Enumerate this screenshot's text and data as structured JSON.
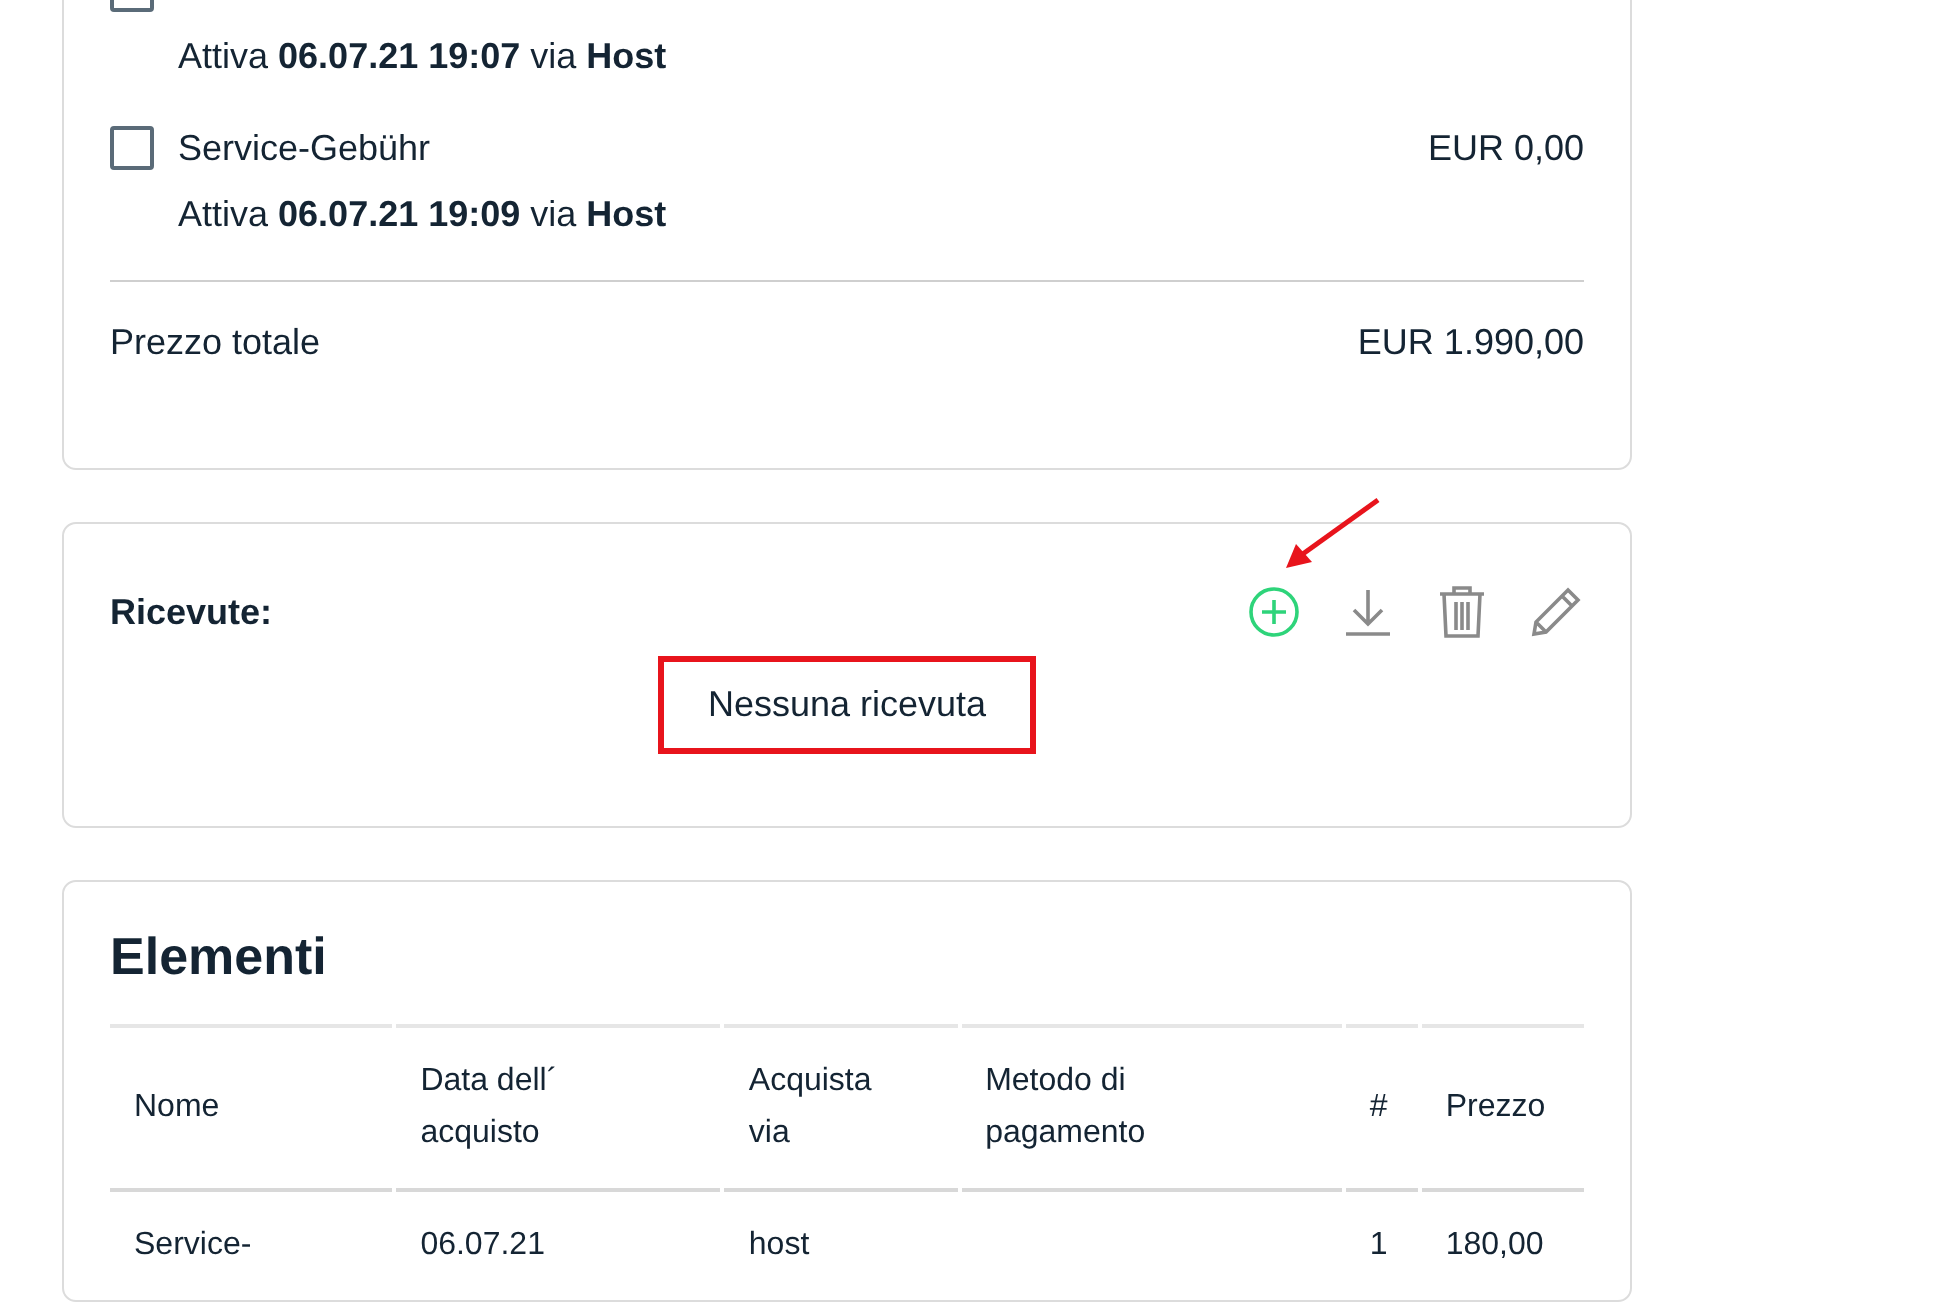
{
  "order_items": [
    {
      "checked": false,
      "details": "Attiva **06.07.21 19:07** via **Host**"
    },
    {
      "name": "Service-Gebühr",
      "checked": false,
      "price": "EUR 0,00",
      "details": "Attiva **06.07.21 19:09** via **Host**"
    }
  ],
  "total": {
    "label": "Prezzo totale",
    "value": "EUR 1.990,00"
  },
  "receipts": {
    "label": "Ricevute:",
    "actions": [
      {
        "kind": "add"
      },
      {
        "kind": "download"
      },
      {
        "kind": "delete"
      },
      {
        "kind": "edit"
      }
    ],
    "annotation": {
      "kind": "arrow"
    },
    "empty_message": "Nessuna ricevuta",
    "highlighted": true
  },
  "elements": {
    "title": "Elementi",
    "columns": [
      "Nome",
      "Data dell´ acquisto",
      "Acquista via",
      "Metodo di pagamento",
      "#",
      "Prezzo"
    ],
    "rows": [
      [
        "Service-",
        "06.07.21",
        "host",
        "",
        "1",
        "180,00"
      ]
    ]
  }
}
